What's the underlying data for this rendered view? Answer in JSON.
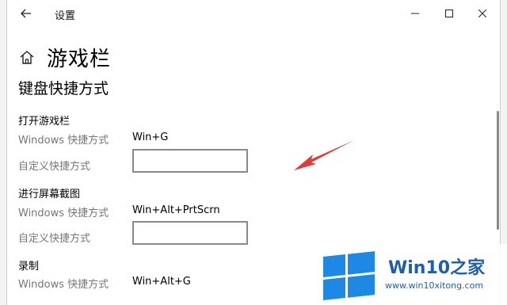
{
  "window": {
    "title": "设置",
    "controls": [
      "minimize-icon",
      "maximize-icon",
      "close-icon"
    ]
  },
  "header": {
    "page_title": "游戏栏"
  },
  "section": {
    "title": "键盘快捷方式"
  },
  "groups": [
    {
      "title": "打开游戏栏",
      "windows_label": "Windows 快捷方式",
      "windows_value": "Win+G",
      "custom_label": "自定义快捷方式",
      "custom_value": ""
    },
    {
      "title": "进行屏幕截图",
      "windows_label": "Windows 快捷方式",
      "windows_value": "Win+Alt+PrtScrn",
      "custom_label": "自定义快捷方式",
      "custom_value": ""
    },
    {
      "title": "录制",
      "windows_label": "Windows 快捷方式",
      "windows_value": "Win+Alt+G"
    }
  ],
  "watermark": {
    "brand": "Win10之家",
    "url": "www.win10xitong.com"
  },
  "colors": {
    "accent": "#1f5ea8",
    "annotation": "#e53935",
    "secondary_text": "#767676"
  }
}
